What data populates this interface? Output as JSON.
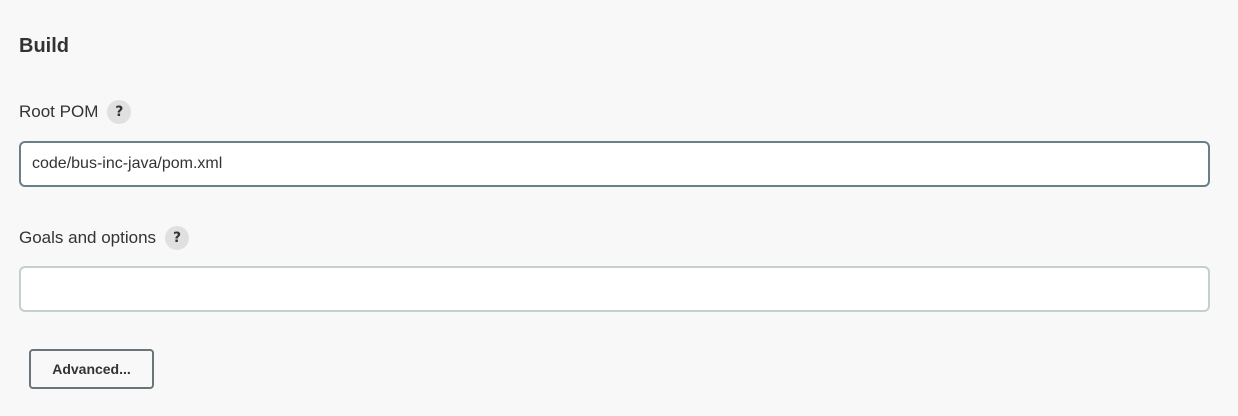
{
  "section": {
    "title": "Build"
  },
  "root_pom": {
    "label": "Root POM",
    "help": "?",
    "value": "code/bus-inc-java/pom.xml"
  },
  "goals": {
    "label": "Goals and options",
    "help": "?",
    "value": ""
  },
  "advanced_button": {
    "label": "Advanced..."
  },
  "icons": {
    "help": "help-icon"
  },
  "colors": {
    "background": "#f8f8f8",
    "input_border_focused": "#6b7f88",
    "input_border": "#c5cfcf",
    "help_icon_bg": "#e0e0e0",
    "text": "#333333"
  }
}
